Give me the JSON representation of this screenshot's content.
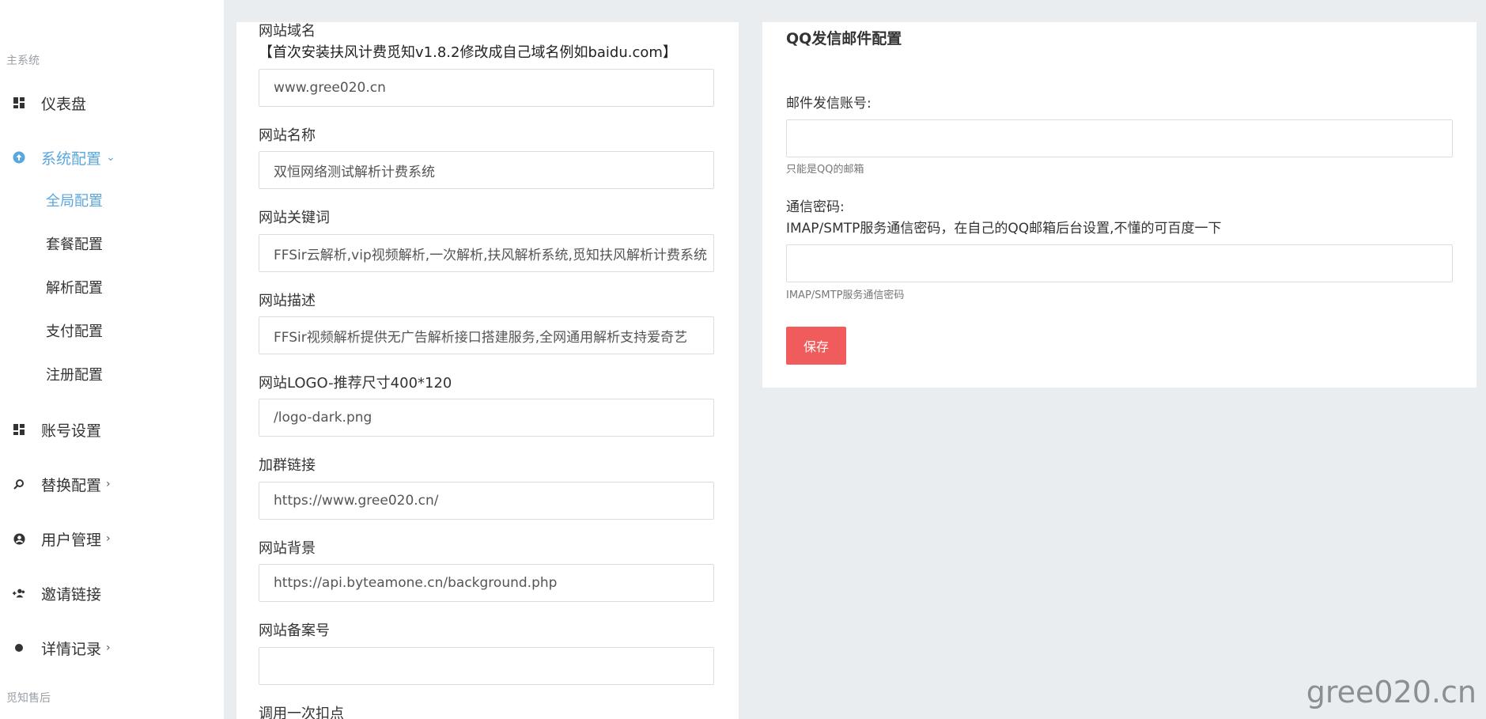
{
  "sidebar": {
    "section_main": "主系统",
    "section_after": "觅知售后",
    "items": [
      {
        "label": "仪表盘",
        "icon": "dashboard-icon"
      },
      {
        "label": "系统配置",
        "icon": "upload-circle-icon"
      },
      {
        "label": "账号设置",
        "icon": "dashboard-icon"
      },
      {
        "label": "替换配置",
        "icon": "search-replace-icon"
      },
      {
        "label": "用户管理",
        "icon": "user-circle-icon"
      },
      {
        "label": "邀请链接",
        "icon": "add-user-icon"
      },
      {
        "label": "详情记录",
        "icon": "dot-icon"
      }
    ],
    "sub_items": [
      "全局配置",
      "套餐配置",
      "解析配置",
      "支付配置",
      "注册配置"
    ]
  },
  "form": {
    "domain": {
      "label": "网站域名",
      "hint": "【首次安装扶风计费觅知v1.8.2修改成自己域名例如baidu.com】",
      "value": "www.gree020.cn"
    },
    "site_name": {
      "label": "网站名称",
      "value": "双恒网络测试解析计费系统"
    },
    "keywords": {
      "label": "网站关键词",
      "value": "FFSir云解析,vip视频解析,一次解析,扶风解析系统,觅知扶风解析计费系统"
    },
    "description": {
      "label": "网站描述",
      "value": "FFSir视频解析提供无广告解析接口搭建服务,全网通用解析支持爱奇艺"
    },
    "logo": {
      "label": "网站LOGO-推荐尺寸400*120",
      "value": "/logo-dark.png"
    },
    "group_link": {
      "label": "加群链接",
      "value": "https://www.gree020.cn/"
    },
    "background": {
      "label": "网站背景",
      "value": "https://api.byteamone.cn/background.php"
    },
    "icp": {
      "label": "网站备案号",
      "value": ""
    },
    "deduct": {
      "label": "调用一次扣点"
    }
  },
  "mail": {
    "title": "QQ发信邮件配置",
    "account_label": "邮件发信账号:",
    "account_value": "",
    "account_help": "只能是QQ的邮箱",
    "password_label": "通信密码:",
    "password_hint": "IMAP/SMTP服务通信密码，在自己的QQ邮箱后台设置,不懂的可百度一下",
    "password_value": "",
    "password_help": "IMAP/SMTP服务通信密码",
    "save_label": "保存"
  },
  "watermark": "gree020.cn",
  "colors": {
    "accent": "#5aa7dd",
    "save_button": "#f05b5b",
    "page_background": "#eaedf0"
  }
}
